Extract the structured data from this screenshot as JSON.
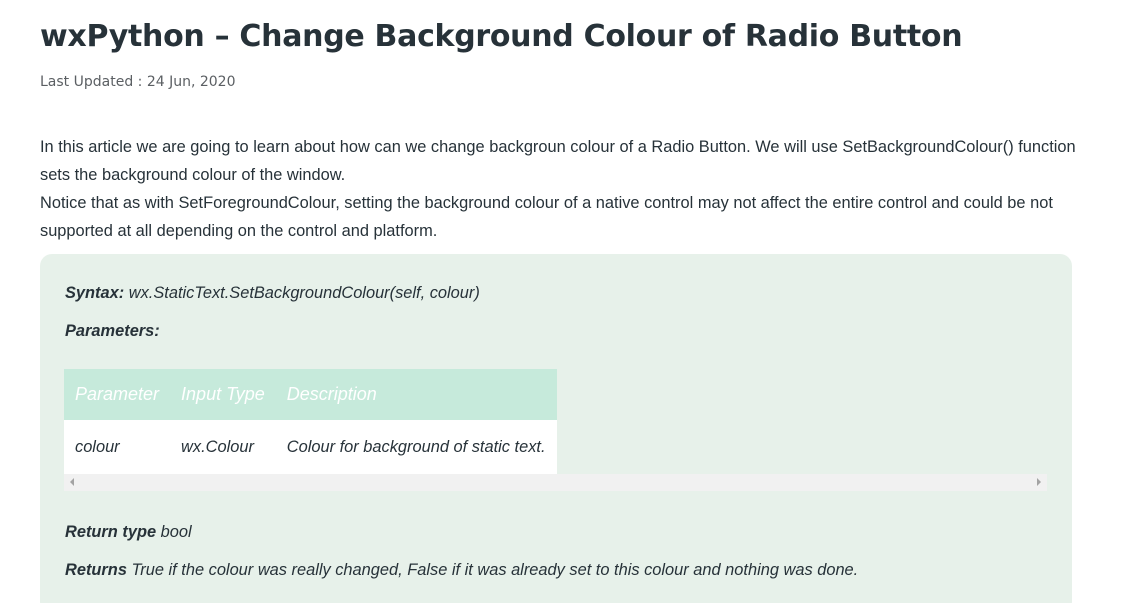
{
  "article": {
    "title": "wxPython – Change Background Colour of Radio Button",
    "last_updated": "Last Updated : 24 Jun, 2020",
    "intro_paragraph_1": "In this article we are going to learn about how can we change backgroun colour of a Radio Button. We will use SetBackgroundColour() function sets the background colour of the window.",
    "intro_paragraph_2": "Notice that as with SetForegroundColour, setting the background colour of a native control may not affect the entire control and could be not supported at all depending on the control and platform."
  },
  "syntax_box": {
    "syntax_label": "Syntax:",
    "syntax_value": " wx.StaticText.SetBackgroundColour(self, colour)",
    "parameters_label": "Parameters:",
    "table": {
      "headers": [
        "Parameter",
        "Input Type",
        "Description"
      ],
      "rows": [
        [
          "colour",
          "wx.Colour",
          "Colour for background of static text."
        ]
      ]
    },
    "return_type_label": "Return type",
    "return_type_value": " bool",
    "returns_label": "Returns",
    "returns_value": " True if the colour was really changed, False if it was already set to this colour and nothing was done."
  },
  "colors": {
    "text": "#273239",
    "box_background": "#e7f1ea",
    "table_header": "#c6eadb",
    "scrollbar": "#f1f1f1"
  },
  "icons": {
    "scroll_left": "scroll-left-arrow-icon",
    "scroll_right": "scroll-right-arrow-icon"
  }
}
